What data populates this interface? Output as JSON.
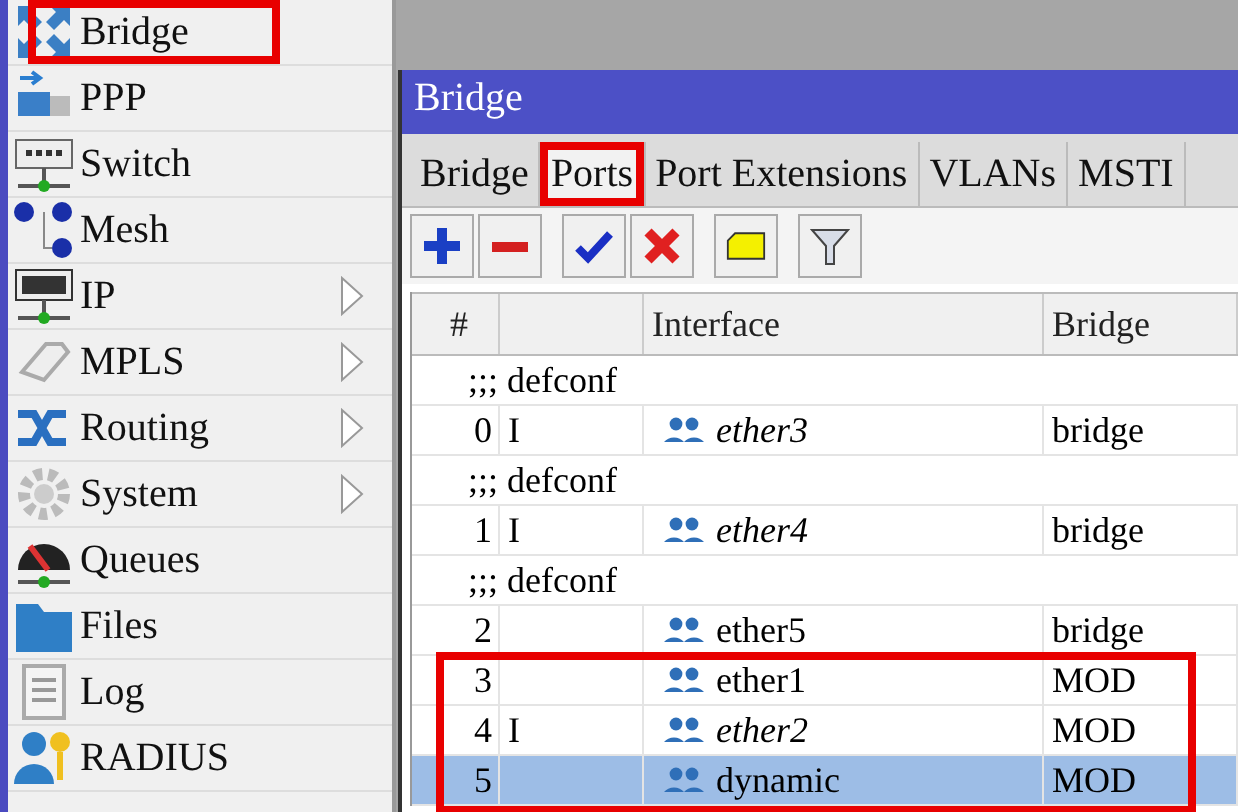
{
  "sidebar": {
    "items": [
      {
        "label": "Bridge",
        "has_submenu": false,
        "annotated": true
      },
      {
        "label": "PPP",
        "has_submenu": false,
        "annotated": false
      },
      {
        "label": "Switch",
        "has_submenu": false,
        "annotated": false
      },
      {
        "label": "Mesh",
        "has_submenu": false,
        "annotated": false
      },
      {
        "label": "IP",
        "has_submenu": true,
        "annotated": false
      },
      {
        "label": "MPLS",
        "has_submenu": true,
        "annotated": false
      },
      {
        "label": "Routing",
        "has_submenu": true,
        "annotated": false
      },
      {
        "label": "System",
        "has_submenu": true,
        "annotated": false
      },
      {
        "label": "Queues",
        "has_submenu": false,
        "annotated": false
      },
      {
        "label": "Files",
        "has_submenu": false,
        "annotated": false
      },
      {
        "label": "Log",
        "has_submenu": false,
        "annotated": false
      },
      {
        "label": "RADIUS",
        "has_submenu": false,
        "annotated": false
      }
    ]
  },
  "window": {
    "title": "Bridge",
    "tabs": [
      {
        "label": "Bridge",
        "selected": false,
        "annotated": false
      },
      {
        "label": "Ports",
        "selected": true,
        "annotated": true
      },
      {
        "label": "Port Extensions",
        "selected": false,
        "annotated": false
      },
      {
        "label": "VLANs",
        "selected": false,
        "annotated": false
      },
      {
        "label": "MSTI",
        "selected": false,
        "annotated": false
      }
    ],
    "table": {
      "columns": [
        "#",
        "Interface",
        "Bridge"
      ],
      "rows": [
        {
          "kind": "comment",
          "text": ";;; defconf"
        },
        {
          "kind": "port",
          "number": "0",
          "flag": "I",
          "interface": "ether3",
          "bridge": "bridge",
          "inactive": true,
          "selected": false,
          "annotated": false
        },
        {
          "kind": "comment",
          "text": ";;; defconf"
        },
        {
          "kind": "port",
          "number": "1",
          "flag": "I",
          "interface": "ether4",
          "bridge": "bridge",
          "inactive": true,
          "selected": false,
          "annotated": false
        },
        {
          "kind": "comment",
          "text": ";;; defconf"
        },
        {
          "kind": "port",
          "number": "2",
          "interface": "ether5",
          "bridge": "bridge",
          "inactive": false,
          "selected": false,
          "annotated": false
        },
        {
          "kind": "port",
          "number": "3",
          "interface": "ether1",
          "bridge": "MOD",
          "inactive": false,
          "selected": false,
          "annotated": true
        },
        {
          "kind": "port",
          "number": "4",
          "flag": "I",
          "interface": "ether2",
          "bridge": "MOD",
          "inactive": true,
          "selected": false,
          "annotated": true
        },
        {
          "kind": "port",
          "number": "5",
          "interface": "dynamic",
          "bridge": "MOD",
          "inactive": false,
          "selected": true,
          "annotated": true
        }
      ]
    }
  }
}
